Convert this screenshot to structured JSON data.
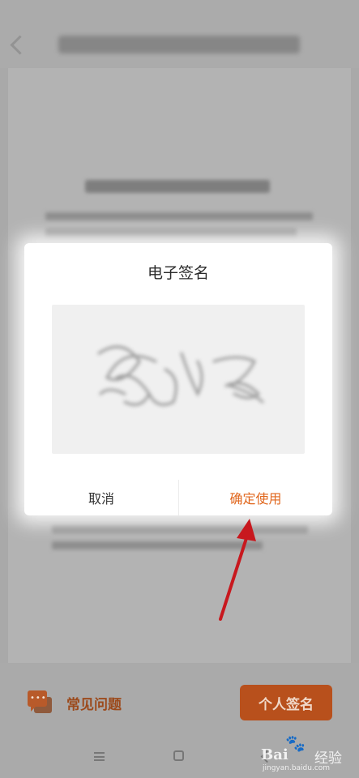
{
  "dialog": {
    "title": "电子签名",
    "cancel_label": "取消",
    "confirm_label": "确定使用"
  },
  "bottom_bar": {
    "faq_label": "常见问题",
    "personal_sign_label": "个人签名"
  },
  "watermark": {
    "brand": "Bai",
    "brand_cn": "经验",
    "url": "jingyan.baidu.com"
  },
  "colors": {
    "accent": "#e0661c",
    "button_bg": "#b8501c",
    "arrow": "#c8181e",
    "overlay": "#a9a9a9"
  },
  "icons": {
    "faq": "chat-bubbles-icon",
    "back": "back-arrow-icon",
    "menu": "menu-icon",
    "home": "home-icon",
    "nav_back": "nav-back-icon",
    "paw": "baidu-paw-icon"
  }
}
